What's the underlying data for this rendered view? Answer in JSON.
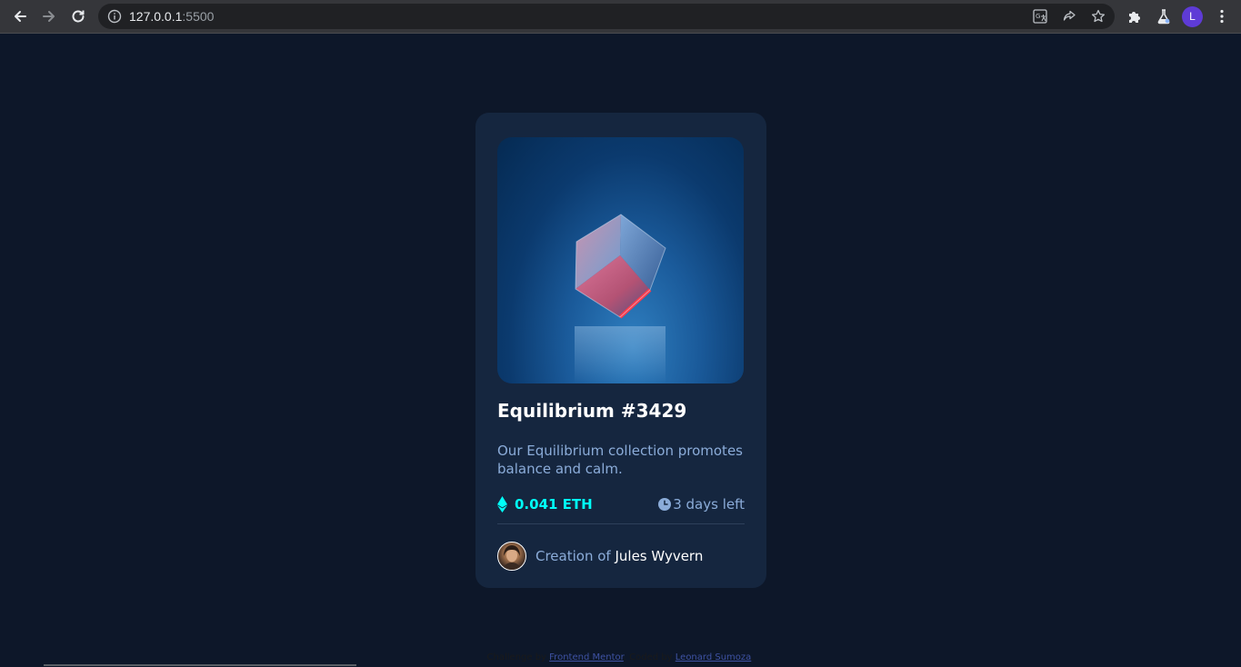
{
  "browser": {
    "url_host": "127.0.0.1",
    "url_port": ":5500",
    "profile_initial": "L",
    "icons": {
      "back": "back-arrow-icon",
      "forward": "forward-arrow-icon",
      "reload": "reload-icon",
      "site_info": "info-icon",
      "translate": "translate-icon",
      "share": "share-icon",
      "bookmark": "star-icon",
      "extensions": "puzzle-icon",
      "labs": "flask-icon",
      "menu": "kebab-menu-icon"
    }
  },
  "card": {
    "title": "Equilibrium #3429",
    "description": "Our Equilibrium collection promotes balance and calm.",
    "price": "0.041 ETH",
    "time_left": "3 days left",
    "creator_prefix": "Creation of ",
    "creator_name": "Jules Wyvern"
  },
  "footer": {
    "challenge_prefix": "Challenge by ",
    "challenge_link": "Frontend Mentor",
    "coded_prefix": ". Coded by ",
    "coded_link": "Leonard Sumoza",
    "suffix": "."
  },
  "colors": {
    "page_bg": "#0d1729",
    "card_bg": "#15263f",
    "cyan": "#00fff8",
    "soft_blue": "#8bacd9",
    "white": "#ffffff"
  }
}
